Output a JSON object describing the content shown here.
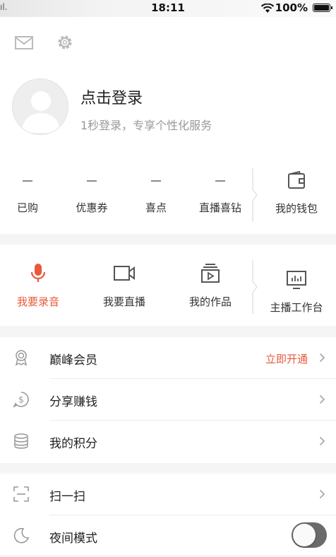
{
  "status_bar": {
    "carrier": "ıl.",
    "time": "18:11",
    "battery": "100%"
  },
  "header": {
    "icons": [
      "mail-icon",
      "settings-gear-icon"
    ]
  },
  "profile": {
    "title": "点击登录",
    "subtitle": "1秒登录，专享个性化服务"
  },
  "stats": [
    {
      "value": "—",
      "label": "已购"
    },
    {
      "value": "—",
      "label": "优惠券"
    },
    {
      "value": "—",
      "label": "喜点"
    },
    {
      "value": "—",
      "label": "直播喜钻"
    }
  ],
  "wallet": {
    "label": "我的钱包",
    "icon": "wallet-icon"
  },
  "creator": [
    {
      "label": "我要录音",
      "icon": "microphone-icon",
      "active": true
    },
    {
      "label": "我要直播",
      "icon": "video-camera-icon"
    },
    {
      "label": "我的作品",
      "icon": "play-works-icon"
    }
  ],
  "studio": {
    "label": "主播工作台",
    "icon": "monitor-chart-icon"
  },
  "menu": {
    "vip": {
      "label": "巅峰会员",
      "action": "立即开通",
      "icon": "badge-icon"
    },
    "share": {
      "label": "分享赚钱",
      "icon": "dollar-icon"
    },
    "points": {
      "label": "我的积分",
      "icon": "coin-stack-icon"
    },
    "scan": {
      "label": "扫一扫",
      "icon": "scan-icon"
    },
    "night": {
      "label": "夜间模式",
      "icon": "moon-icon",
      "enabled": false
    }
  },
  "colors": {
    "accent": "#e8583a",
    "background": "#f5f5f5",
    "toggle_off": "#6b6b6b"
  }
}
